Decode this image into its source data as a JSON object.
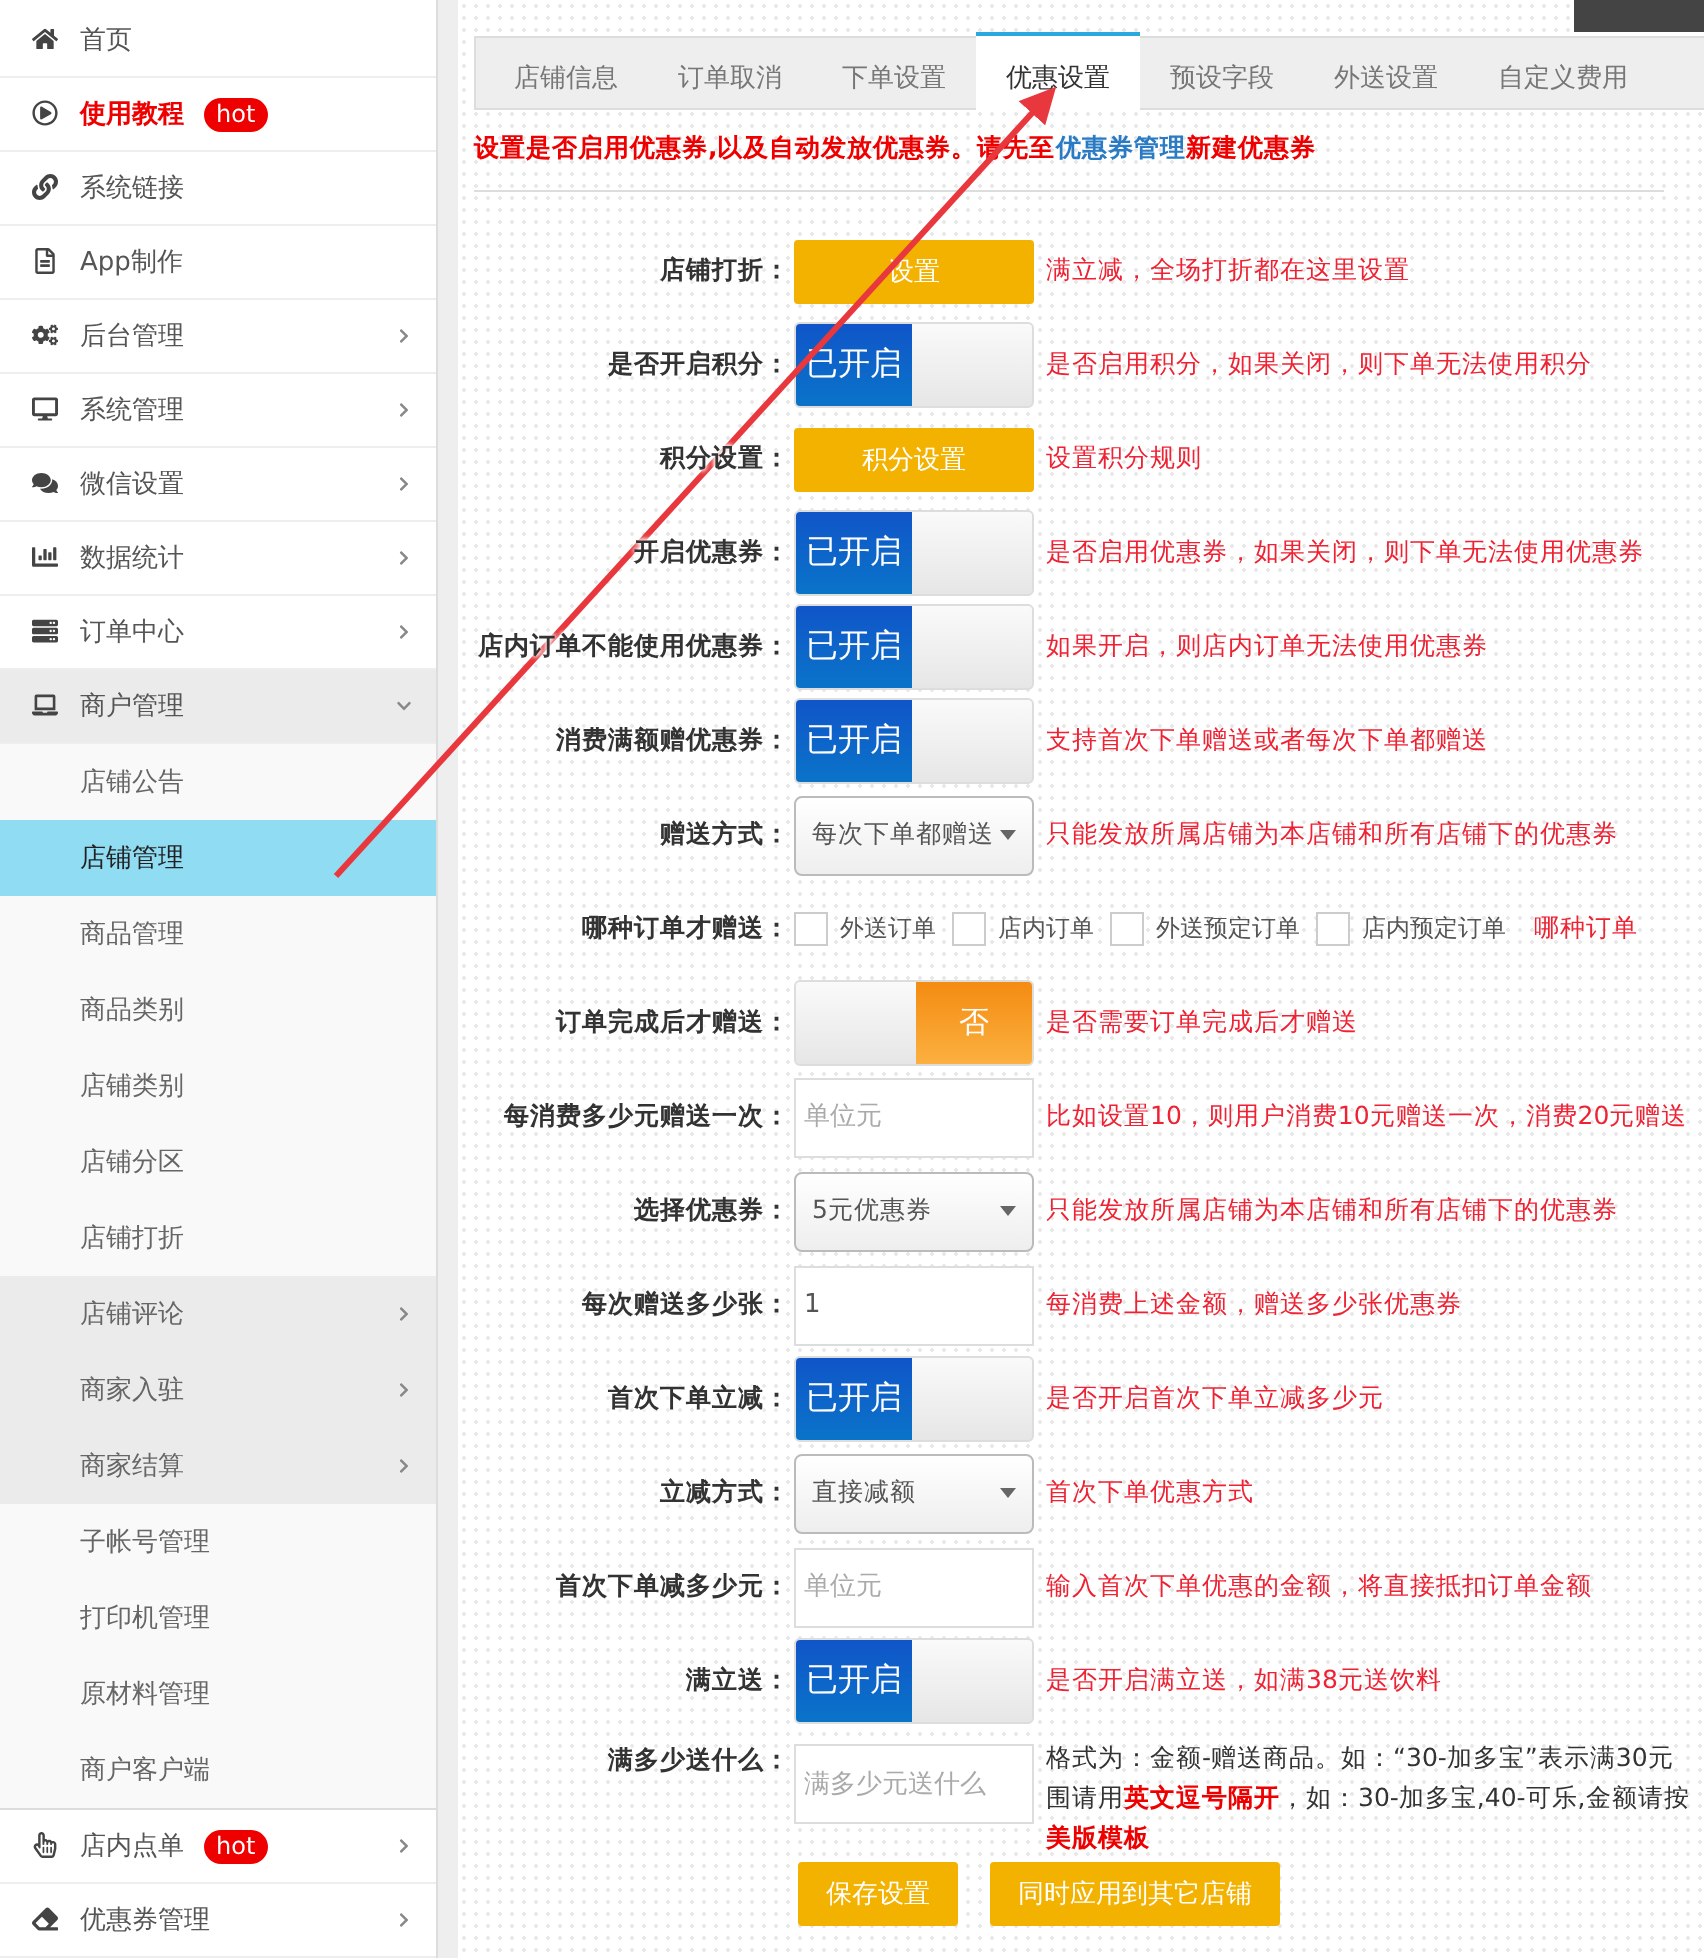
{
  "sidebar": {
    "items": [
      {
        "label": "首页",
        "highlight": false,
        "has_submenu": false,
        "expanded": false
      },
      {
        "label": "使用教程",
        "badge": "hot",
        "highlight": true,
        "has_submenu": false,
        "expanded": false
      },
      {
        "label": "系统链接",
        "highlight": false,
        "has_submenu": false,
        "expanded": false
      },
      {
        "label": "App制作",
        "highlight": false,
        "has_submenu": false,
        "expanded": false
      },
      {
        "label": "后台管理",
        "highlight": false,
        "has_submenu": true,
        "expanded": false
      },
      {
        "label": "系统管理",
        "highlight": false,
        "has_submenu": true,
        "expanded": false
      },
      {
        "label": "微信设置",
        "highlight": false,
        "has_submenu": true,
        "expanded": false
      },
      {
        "label": "数据统计",
        "highlight": false,
        "has_submenu": true,
        "expanded": false
      },
      {
        "label": "订单中心",
        "highlight": false,
        "has_submenu": true,
        "expanded": false
      },
      {
        "label": "商户管理",
        "highlight": false,
        "has_submenu": true,
        "expanded": true,
        "children": [
          {
            "label": "店铺公告",
            "selected": false,
            "has_submenu": false
          },
          {
            "label": "店铺管理",
            "selected": true,
            "has_submenu": false
          },
          {
            "label": "商品管理",
            "selected": false,
            "has_submenu": false
          },
          {
            "label": "商品类别",
            "selected": false,
            "has_submenu": false
          },
          {
            "label": "店铺类别",
            "selected": false,
            "has_submenu": false
          },
          {
            "label": "店铺分区",
            "selected": false,
            "has_submenu": false
          },
          {
            "label": "店铺打折",
            "selected": false,
            "has_submenu": false
          },
          {
            "label": "店铺评论",
            "selected": false,
            "has_submenu": true
          },
          {
            "label": "商家入驻",
            "selected": false,
            "has_submenu": true
          },
          {
            "label": "商家结算",
            "selected": false,
            "has_submenu": true
          },
          {
            "label": "子帐号管理",
            "selected": false,
            "has_submenu": false
          },
          {
            "label": "打印机管理",
            "selected": false,
            "has_submenu": false
          },
          {
            "label": "原材料管理",
            "selected": false,
            "has_submenu": false
          },
          {
            "label": "商户客户端",
            "selected": false,
            "has_submenu": false
          }
        ]
      },
      {
        "label": "店内点单",
        "badge": "hot",
        "highlight": false,
        "has_submenu": true,
        "expanded": false
      },
      {
        "label": "优惠券管理",
        "highlight": false,
        "has_submenu": true,
        "expanded": false
      }
    ]
  },
  "tabs": [
    {
      "label": "店铺信息",
      "selected": false
    },
    {
      "label": "订单取消",
      "selected": false
    },
    {
      "label": "下单设置",
      "selected": false
    },
    {
      "label": "优惠设置",
      "selected": true
    },
    {
      "label": "预设字段",
      "selected": false
    },
    {
      "label": "外送设置",
      "selected": false
    },
    {
      "label": "自定义费用",
      "selected": false
    }
  ],
  "notice": "**设置是否启用优惠券,以及自动发放优惠券。请先至**",
  "notice_link": "优惠券管理",
  "notice_end": "**新建优惠券**",
  "form": [
    {
      "kind": "button",
      "label": "店铺打折：",
      "text": "设置",
      "hint": "满立减，全场打折都在这里设置"
    },
    {
      "kind": "toggle",
      "label": "是否开启积分：",
      "on": true,
      "text": "已开启",
      "hint": "是否启用积分，如果关闭，则下单无法使用积分"
    },
    {
      "kind": "button",
      "label": "积分设置：",
      "text": "积分设置",
      "hint": "设置积分规则"
    },
    {
      "kind": "toggle",
      "label": "开启优惠券：",
      "on": true,
      "text": "已开启",
      "hint": "是否启用优惠券，如果关闭，则下单无法使用优惠券"
    },
    {
      "kind": "toggle",
      "label": "店内订单不能使用优惠券：",
      "on": true,
      "text": "已开启",
      "hint": "如果开启，则店内订单无法使用优惠券"
    },
    {
      "kind": "toggle",
      "label": "消费满额赠优惠券：",
      "on": true,
      "text": "已开启",
      "hint": "支持首次下单赠送或者每次下单都赠送"
    },
    {
      "kind": "select",
      "label": "赠送方式：",
      "value": "每次下单都赠送",
      "hint": "只能发放所属店铺为本店铺和所有店铺下的优惠券"
    },
    {
      "kind": "checkboxes",
      "label": "哪种订单才赠送：",
      "options": [
        {
          "label": "外送订单",
          "checked": false
        },
        {
          "label": "店内订单",
          "checked": false
        },
        {
          "label": "外送预定订单",
          "checked": false
        },
        {
          "label": "店内预定订单",
          "checked": false
        }
      ],
      "hint": "哪种订单"
    },
    {
      "kind": "toggle",
      "label": "订单完成后才赠送：",
      "on": false,
      "text": "否",
      "hint": "是否需要订单完成后才赠送"
    },
    {
      "kind": "input",
      "label": "每消费多少元赠送一次：",
      "placeholder": "单位元",
      "hint": "比如设置10，则用户消费10元赠送一次，消费20元赠送"
    },
    {
      "kind": "select",
      "label": "选择优惠券：",
      "value": "5元优惠券",
      "hint": "只能发放所属店铺为本店铺和所有店铺下的优惠券"
    },
    {
      "kind": "input",
      "label": "每次赠送多少张：",
      "value": "1",
      "hint": "每消费上述金额，赠送多少张优惠券"
    },
    {
      "kind": "toggle",
      "label": "首次下单立减：",
      "on": true,
      "text": "已开启",
      "hint": "是否开启首次下单立减多少元"
    },
    {
      "kind": "select",
      "label": "立减方式：",
      "value": "直接减额",
      "hint": "首次下单优惠方式"
    },
    {
      "kind": "input",
      "label": "首次下单减多少元：",
      "placeholder": "单位元",
      "hint": "输入首次下单优惠的金额，将直接抵扣订单金额"
    },
    {
      "kind": "toggle",
      "label": "满立送：",
      "on": true,
      "text": "已开启",
      "hint": "是否开启满立送，如满38元送饮料"
    },
    {
      "kind": "input",
      "label": "满多少送什么：",
      "placeholder": "满多少元送什么",
      "hint_lines": [
        "格式为：金额-赠送商品。如：“30-加多宝”表示满30元",
        "围请用**英文逗号隔开**，如：30-加多宝,40-可乐,金额请按",
        "**美版模板**"
      ]
    }
  ],
  "actions": [
    "保存设置",
    "同时应用到其它店铺"
  ]
}
